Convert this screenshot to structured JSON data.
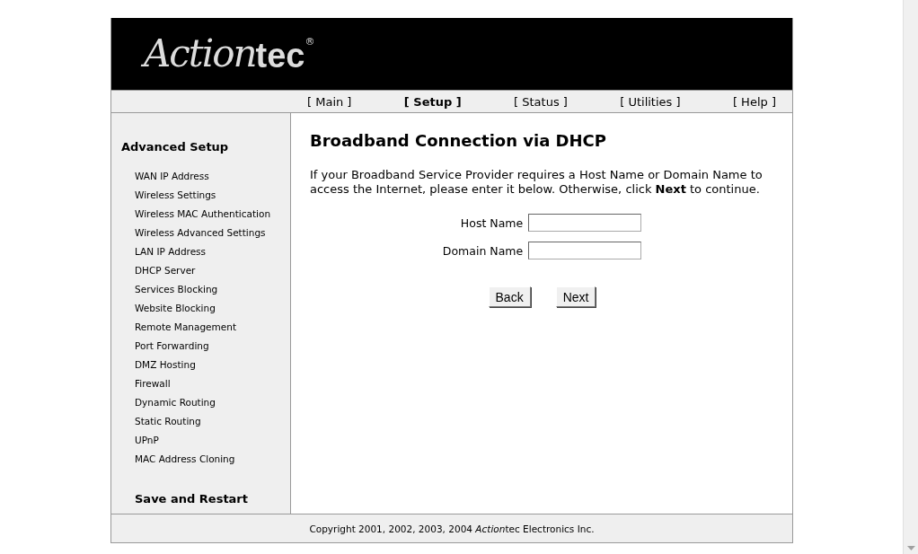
{
  "logo": {
    "script": "Action",
    "bold": "tec",
    "mark": "®"
  },
  "nav": [
    {
      "label": "[ Main ]",
      "selected": false
    },
    {
      "label": "[ Setup ]",
      "selected": true
    },
    {
      "label": "[ Status ]",
      "selected": false
    },
    {
      "label": "[ Utilities ]",
      "selected": false
    },
    {
      "label": "[ Help ]",
      "selected": false
    }
  ],
  "sidebar": {
    "heading": "Advanced Setup",
    "items": [
      "WAN IP Address",
      "Wireless Settings",
      "Wireless MAC Authentication",
      "Wireless Advanced Settings",
      "LAN IP Address",
      "DHCP Server",
      "Services Blocking",
      "Website Blocking",
      "Remote Management",
      "Port Forwarding",
      "DMZ Hosting",
      "Firewall",
      "Dynamic Routing",
      "Static Routing",
      "UPnP",
      "MAC Address Cloning"
    ],
    "footer_link": "Save and Restart"
  },
  "content": {
    "title": "Broadband Connection via DHCP",
    "intro": "If your Broadband Service Provider requires a Host Name or Domain Name to access the Internet, please enter it below. Otherwise, click **Next** to continue.",
    "fields": [
      {
        "label": "Host Name"
      },
      {
        "label": "Domain Name"
      }
    ],
    "buttons": [
      "Back",
      "Next"
    ]
  },
  "footer": {
    "before": "Copyright 2001, 2002, 2003, 2004 ",
    "italic": "Action",
    "after": "tec Electronics Inc."
  }
}
